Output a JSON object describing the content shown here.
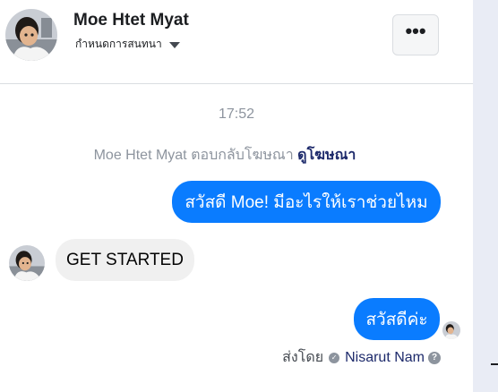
{
  "header": {
    "contact_name": "Moe Htet Myat",
    "action_label": "กำหนดการสนทนา",
    "more_label": "•••"
  },
  "conversation": {
    "timestamp": "17:52",
    "system_note": {
      "text": "Moe Htet Myat ตอบกลับโฆษณา",
      "link": "ดูโฆษณา"
    },
    "messages": [
      {
        "direction": "outgoing",
        "text": "สวัสดี Moe! มีอะไรให้เราช่วยไหม"
      },
      {
        "direction": "incoming",
        "text": "GET STARTED"
      },
      {
        "direction": "outgoing",
        "text": "สวัสดีค่ะ"
      }
    ],
    "sent_by": {
      "label": "ส่งโดย",
      "name": "Nisarut Nam",
      "help": "?"
    }
  },
  "colors": {
    "outgoing_bubble": "#0a7cff",
    "incoming_bubble": "#f0f0f0",
    "link": "#1d2a6b",
    "muted_text": "#8d949e",
    "side_strip": "#e9ecf5"
  },
  "icons": [
    "profile-avatar",
    "caret-down-icon",
    "more-options-icon",
    "verified-icon",
    "help-icon"
  ]
}
